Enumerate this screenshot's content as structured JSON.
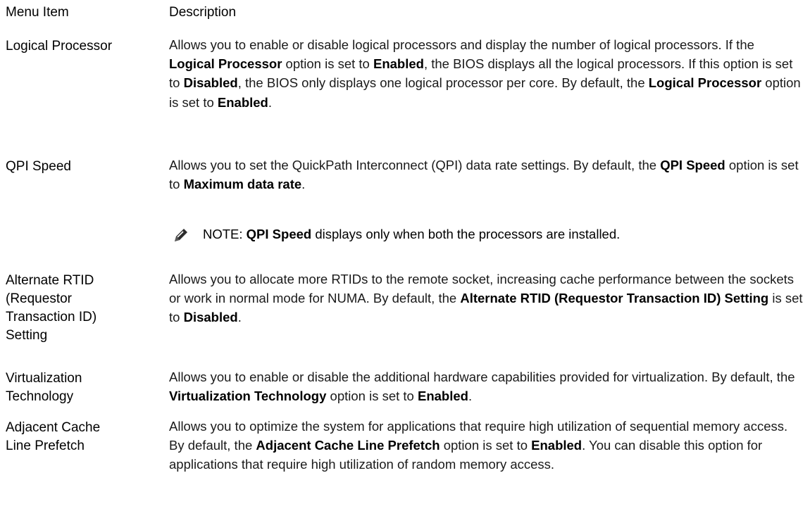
{
  "header": {
    "col1": "Menu Item",
    "col2": "Description"
  },
  "rows": [
    {
      "term": "Logical Processor",
      "desc": [
        {
          "t": "Allows you to enable or disable logical processors and display the number of logical processors. If the "
        },
        {
          "t": "Logical Processor",
          "b": true
        },
        {
          "t": " option is set to "
        },
        {
          "t": "Enabled",
          "b": true
        },
        {
          "t": ", the BIOS displays all the logical processors. If this option is set to "
        },
        {
          "t": "Disabled",
          "b": true
        },
        {
          "t": ", the BIOS only displays one logical processor per core. By default, the "
        },
        {
          "t": "Logical Processor",
          "b": true
        },
        {
          "t": " option is set to "
        },
        {
          "t": "Enabled",
          "b": true
        },
        {
          "t": "."
        }
      ]
    },
    {
      "term": "QPI Speed",
      "desc": [
        {
          "t": "Allows you to set the QuickPath Interconnect (QPI) data rate settings. By default, the "
        },
        {
          "t": "QPI Speed",
          "b": true
        },
        {
          "t": " option is set to "
        },
        {
          "t": "Maximum data rate",
          "b": true
        },
        {
          "t": "."
        }
      ]
    },
    {
      "term": "Alternate RTID\n(Requestor\nTransaction ID)\nSetting",
      "desc": [
        {
          "t": "Allows you to allocate more RTIDs to the remote socket, increasing cache performance between the sockets or work in normal mode for NUMA. By default, the "
        },
        {
          "t": "Alternate RTID (Requestor Transaction ID) Setting",
          "b": true
        },
        {
          "t": " is set to "
        },
        {
          "t": "Disabled",
          "b": true
        },
        {
          "t": "."
        }
      ]
    },
    {
      "term": "Virtualization\nTechnology",
      "desc": [
        {
          "t": "Allows you to enable or disable the additional hardware capabilities provided for virtualization. By default, the "
        },
        {
          "t": "Virtualization Technology",
          "b": true
        },
        {
          "t": " option is set to "
        },
        {
          "t": "Enabled",
          "b": true
        },
        {
          "t": "."
        }
      ]
    },
    {
      "term": "Adjacent Cache\nLine Prefetch",
      "desc": [
        {
          "t": "Allows you to optimize the system for applications that require high utilization of sequential memory access. By default, the "
        },
        {
          "t": "Adjacent Cache Line Prefetch",
          "b": true
        },
        {
          "t": " option is set to "
        },
        {
          "t": "Enabled",
          "b": true
        },
        {
          "t": ". You can disable this option for applications that require high utilization of random memory access."
        }
      ]
    }
  ],
  "note": {
    "icon": "pencil-note-icon",
    "label": "NOTE:",
    "bold": "QPI Speed",
    "rest": " displays only when both the processors are installed."
  }
}
